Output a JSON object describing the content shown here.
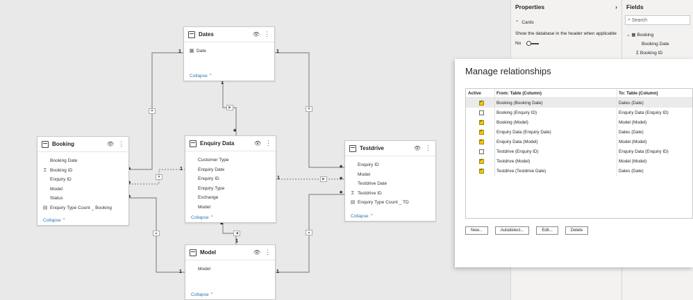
{
  "canvas": {
    "tables": {
      "dates": {
        "title": "Dates",
        "fields": [
          {
            "label": "Date",
            "icon": "calendar-icon"
          }
        ],
        "collapse": "Collapse"
      },
      "enquiry": {
        "title": "Enquiry Data",
        "fields": [
          {
            "label": "Customer Type"
          },
          {
            "label": "Enquiry Date"
          },
          {
            "label": "Enquiry ID"
          },
          {
            "label": "Enquiry Type"
          },
          {
            "label": "Exchange"
          },
          {
            "label": "Model"
          }
        ],
        "collapse": "Collapse"
      },
      "booking": {
        "title": "Booking",
        "fields": [
          {
            "label": "Booking Date"
          },
          {
            "label": "Booking ID",
            "icon": "sigma-icon"
          },
          {
            "label": "Enquiry ID"
          },
          {
            "label": "Model"
          },
          {
            "label": "Status"
          },
          {
            "label": "Enquiry Type Count _ Booking",
            "icon": "calculator-icon"
          }
        ],
        "collapse": "Collapse"
      },
      "testdrive": {
        "title": "Testdrive",
        "fields": [
          {
            "label": "Enquiry ID"
          },
          {
            "label": "Model"
          },
          {
            "label": "Testdrive Date"
          },
          {
            "label": "Testdrive ID",
            "icon": "sigma-icon"
          },
          {
            "label": "Enquiry Type Count _ TD",
            "icon": "calculator-icon"
          }
        ],
        "collapse": "Collapse"
      },
      "model": {
        "title": "Model",
        "fields": [
          {
            "label": "Model"
          }
        ],
        "collapse": "Collapse"
      }
    },
    "marks": {
      "one": "1",
      "many": "*"
    }
  },
  "properties": {
    "title": "Properties",
    "section": "Cards",
    "description": "Show the database in the header when applicable",
    "toggle_label": "No"
  },
  "fields_pane": {
    "title": "Fields",
    "search_placeholder": "Search",
    "table": "Booking",
    "items": [
      "Booking Date",
      "Booking ID"
    ]
  },
  "dialog": {
    "title": "Manage relationships",
    "columns": {
      "active": "Active",
      "from": "From: Table (Column)",
      "to": "To: Table (Column)"
    },
    "rows": [
      {
        "active": true,
        "from": "Booking (Booking Date)",
        "to": "Dates (Date)"
      },
      {
        "active": false,
        "from": "Booking (Enquiry ID)",
        "to": "Enquiry Data (Enquiry ID)"
      },
      {
        "active": true,
        "from": "Booking (Model)",
        "to": "Model (Model)"
      },
      {
        "active": true,
        "from": "Enquiry Data (Enquiry Date)",
        "to": "Dates (Date)"
      },
      {
        "active": true,
        "from": "Enquiry Data (Model)",
        "to": "Model (Model)"
      },
      {
        "active": false,
        "from": "Testdrive (Enquiry ID)",
        "to": "Enquiry Data (Enquiry ID)"
      },
      {
        "active": true,
        "from": "Testdrive (Model)",
        "to": "Model (Model)"
      },
      {
        "active": true,
        "from": "Testdrive (Testdrive Date)",
        "to": "Dates (Date)"
      }
    ],
    "buttons": {
      "new": "New...",
      "autodetect": "Autodetect...",
      "edit": "Edit...",
      "delete": "Delete"
    }
  },
  "colors": {
    "accent": "#f2c811",
    "link": "#2b73b7"
  }
}
